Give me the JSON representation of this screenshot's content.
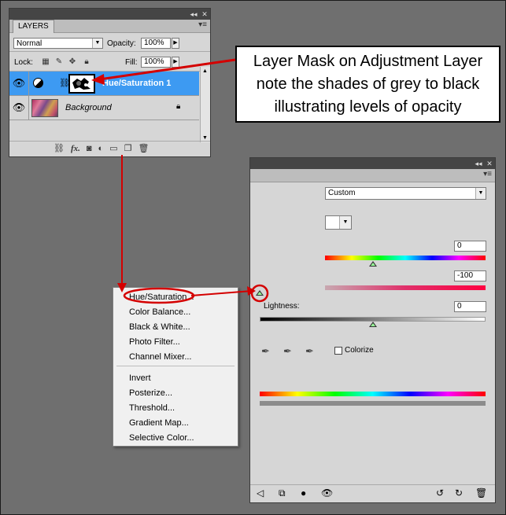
{
  "layers_panel": {
    "tab_label": "LAYERS",
    "blend_mode": "Normal",
    "opacity_label": "Opacity:",
    "opacity_value": "100%",
    "lock_label": "Lock:",
    "fill_label": "Fill:",
    "fill_value": "100%",
    "layers": [
      {
        "name": "Hue/Saturation 1",
        "selected": true
      },
      {
        "name": "Background",
        "selected": false
      }
    ]
  },
  "callout": {
    "lines": [
      "Layer Mask on Adjustment Layer",
      "note the shades of grey to black",
      "illustrating levels of opacity"
    ]
  },
  "adjustments_panel": {
    "preset": "Custom",
    "hue_value": "0",
    "saturation_value": "-100",
    "lightness_label": "Lightness:",
    "lightness_value": "0",
    "colorize_label": "Colorize",
    "colorize_checked": false
  },
  "adjustment_menu": {
    "group1": [
      "Hue/Saturation...",
      "Color Balance...",
      "Black & White...",
      "Photo Filter...",
      "Channel Mixer..."
    ],
    "group2": [
      "Invert",
      "Posterize...",
      "Threshold...",
      "Gradient Map...",
      "Selective Color..."
    ]
  },
  "colors": {
    "annotation_red": "#d40000",
    "selection_blue": "#3d9af2",
    "panel_gray": "#d6d6d6",
    "background_gray": "#6f6f6f"
  }
}
